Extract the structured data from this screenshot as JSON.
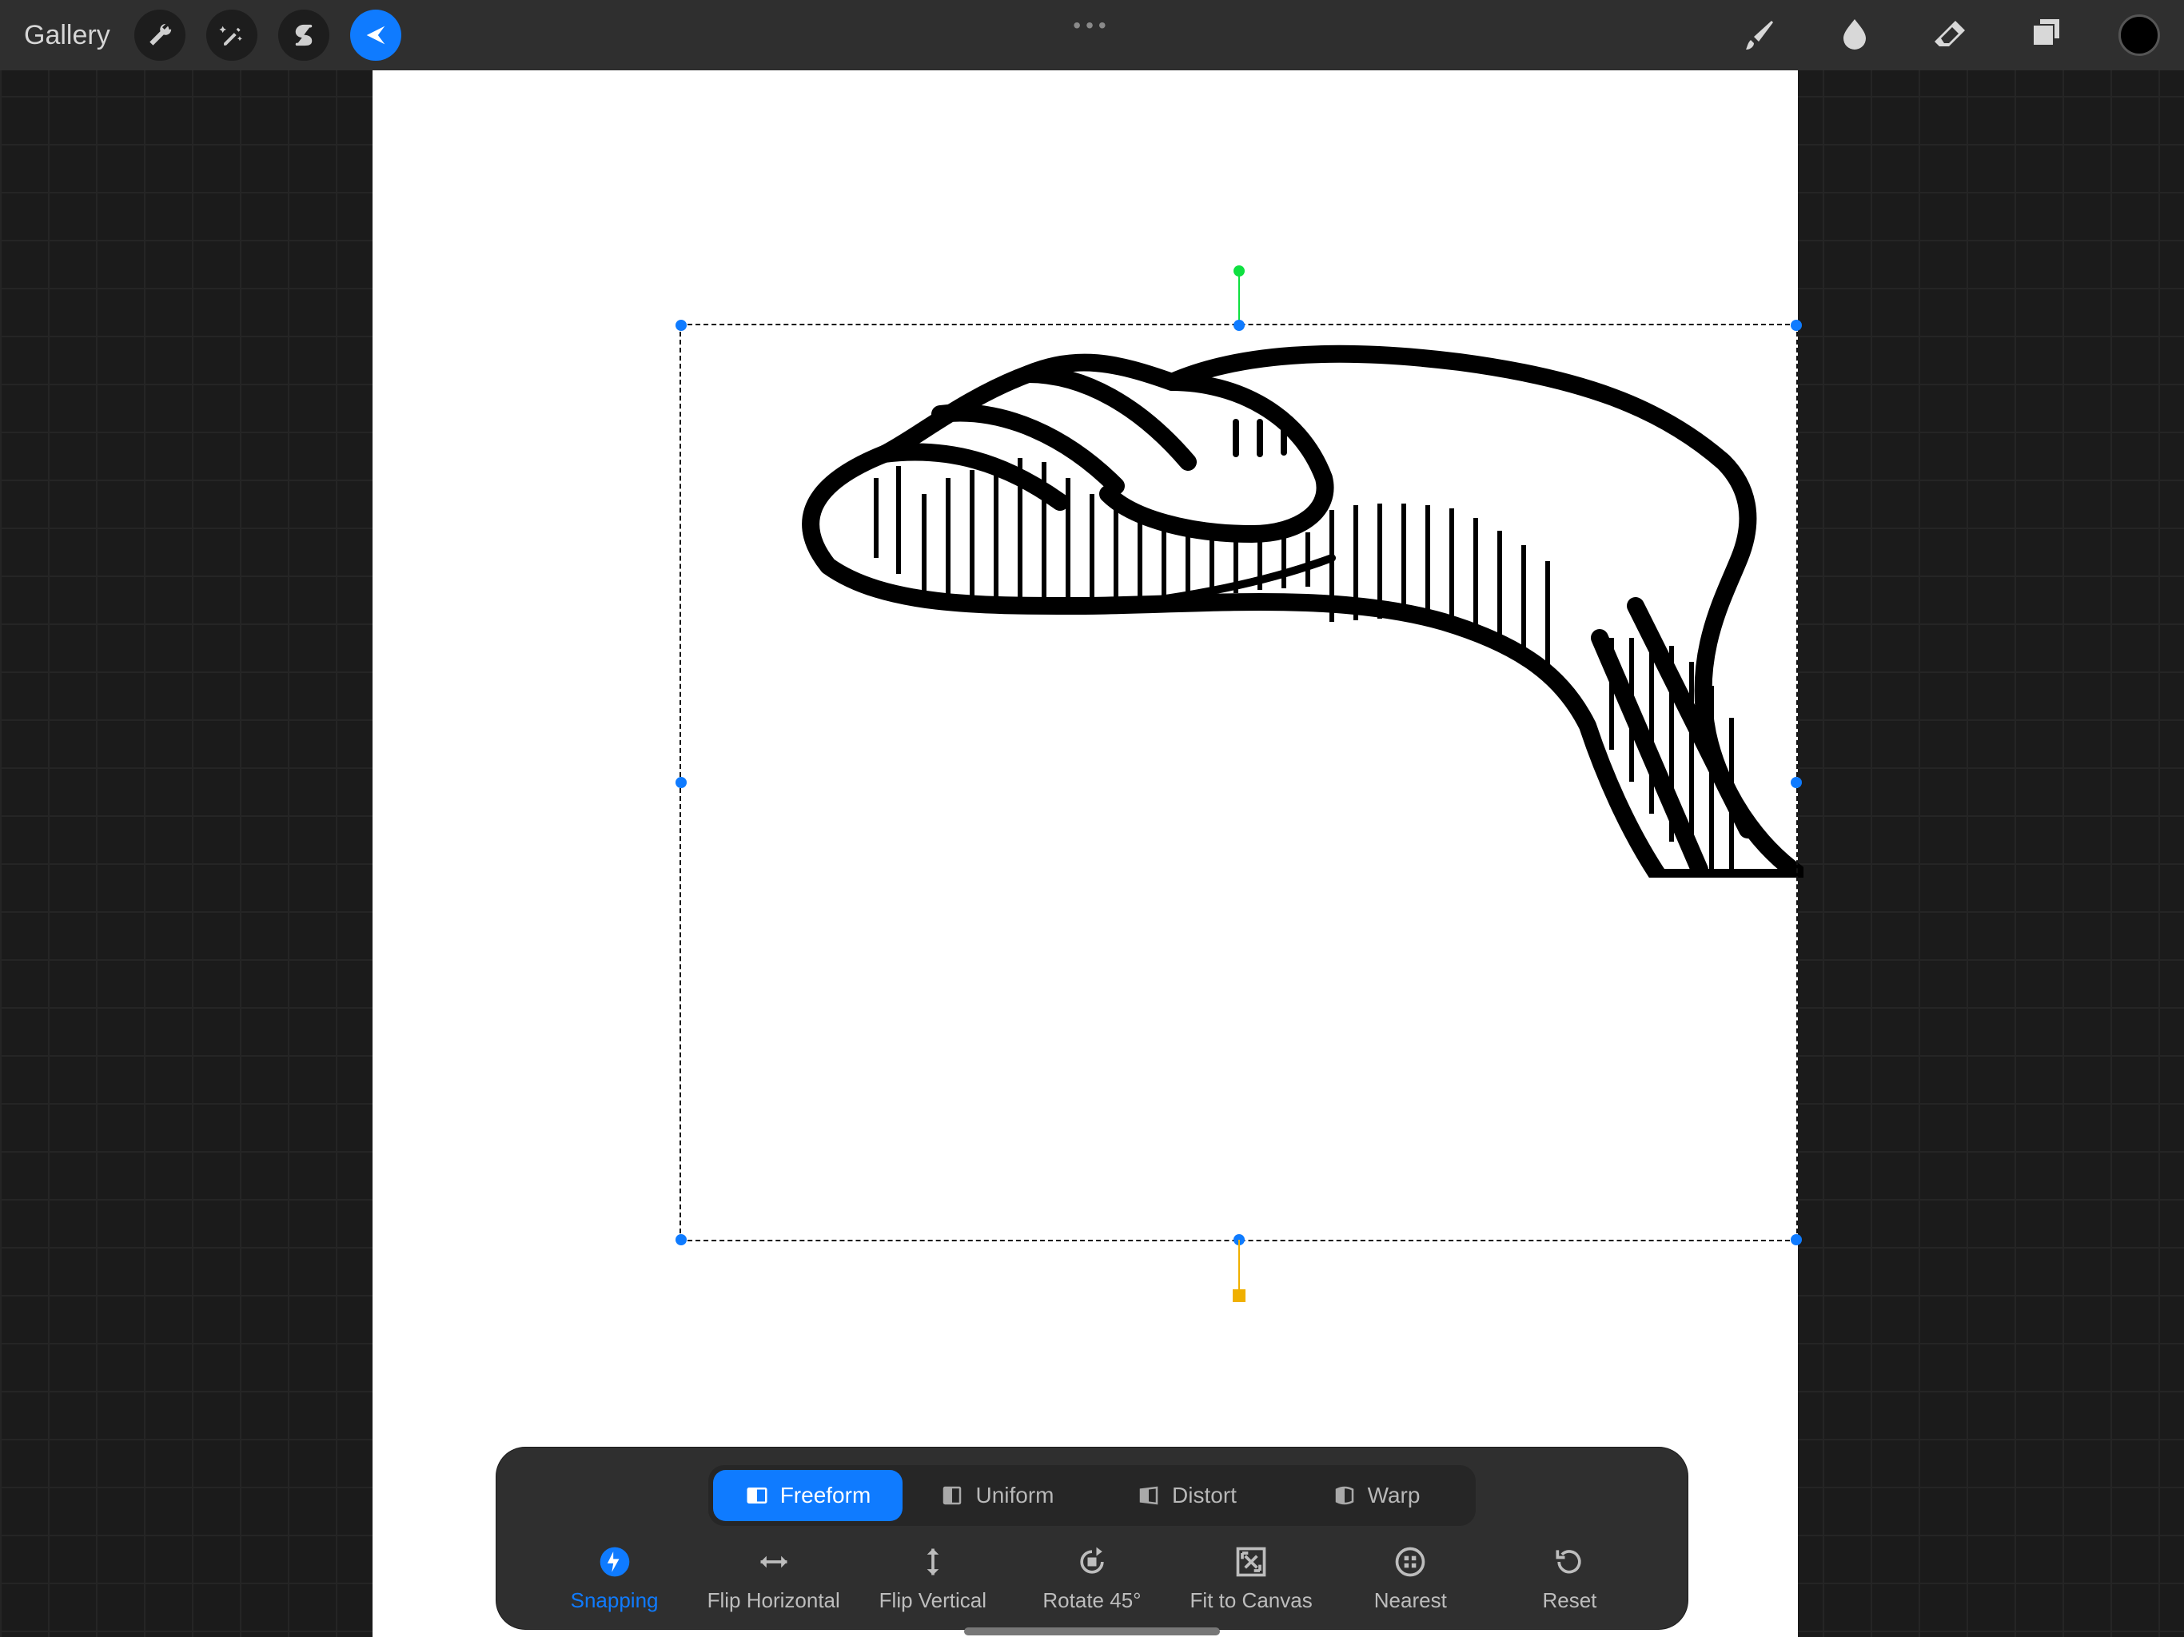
{
  "topbar": {
    "gallery_label": "Gallery",
    "icons": {
      "actions": "wrench-icon",
      "adjustments": "wand-icon",
      "selection": "s-ribbon-icon",
      "transform": "arrow-icon"
    },
    "right_tools": {
      "brush": "brush-icon",
      "smudge": "smudge-icon",
      "erase": "eraser-icon",
      "layers": "layers-icon",
      "color": "#000000"
    }
  },
  "selection": {
    "rotation_handle_color": "#0ee040",
    "node_color": "#0f7bff",
    "bottom_handle_color": "#f0b000"
  },
  "transform_panel": {
    "modes": [
      {
        "key": "freeform",
        "label": "Freeform",
        "active": true
      },
      {
        "key": "uniform",
        "label": "Uniform",
        "active": false
      },
      {
        "key": "distort",
        "label": "Distort",
        "active": false
      },
      {
        "key": "warp",
        "label": "Warp",
        "active": false
      }
    ],
    "actions": [
      {
        "key": "snapping",
        "label": "Snapping",
        "active": true
      },
      {
        "key": "fliph",
        "label": "Flip Horizontal",
        "active": false
      },
      {
        "key": "flipv",
        "label": "Flip Vertical",
        "active": false
      },
      {
        "key": "rot45",
        "label": "Rotate 45°",
        "active": false
      },
      {
        "key": "fit",
        "label": "Fit to Canvas",
        "active": false
      },
      {
        "key": "nearest",
        "label": "Nearest",
        "active": false
      },
      {
        "key": "reset",
        "label": "Reset",
        "active": false
      }
    ]
  }
}
